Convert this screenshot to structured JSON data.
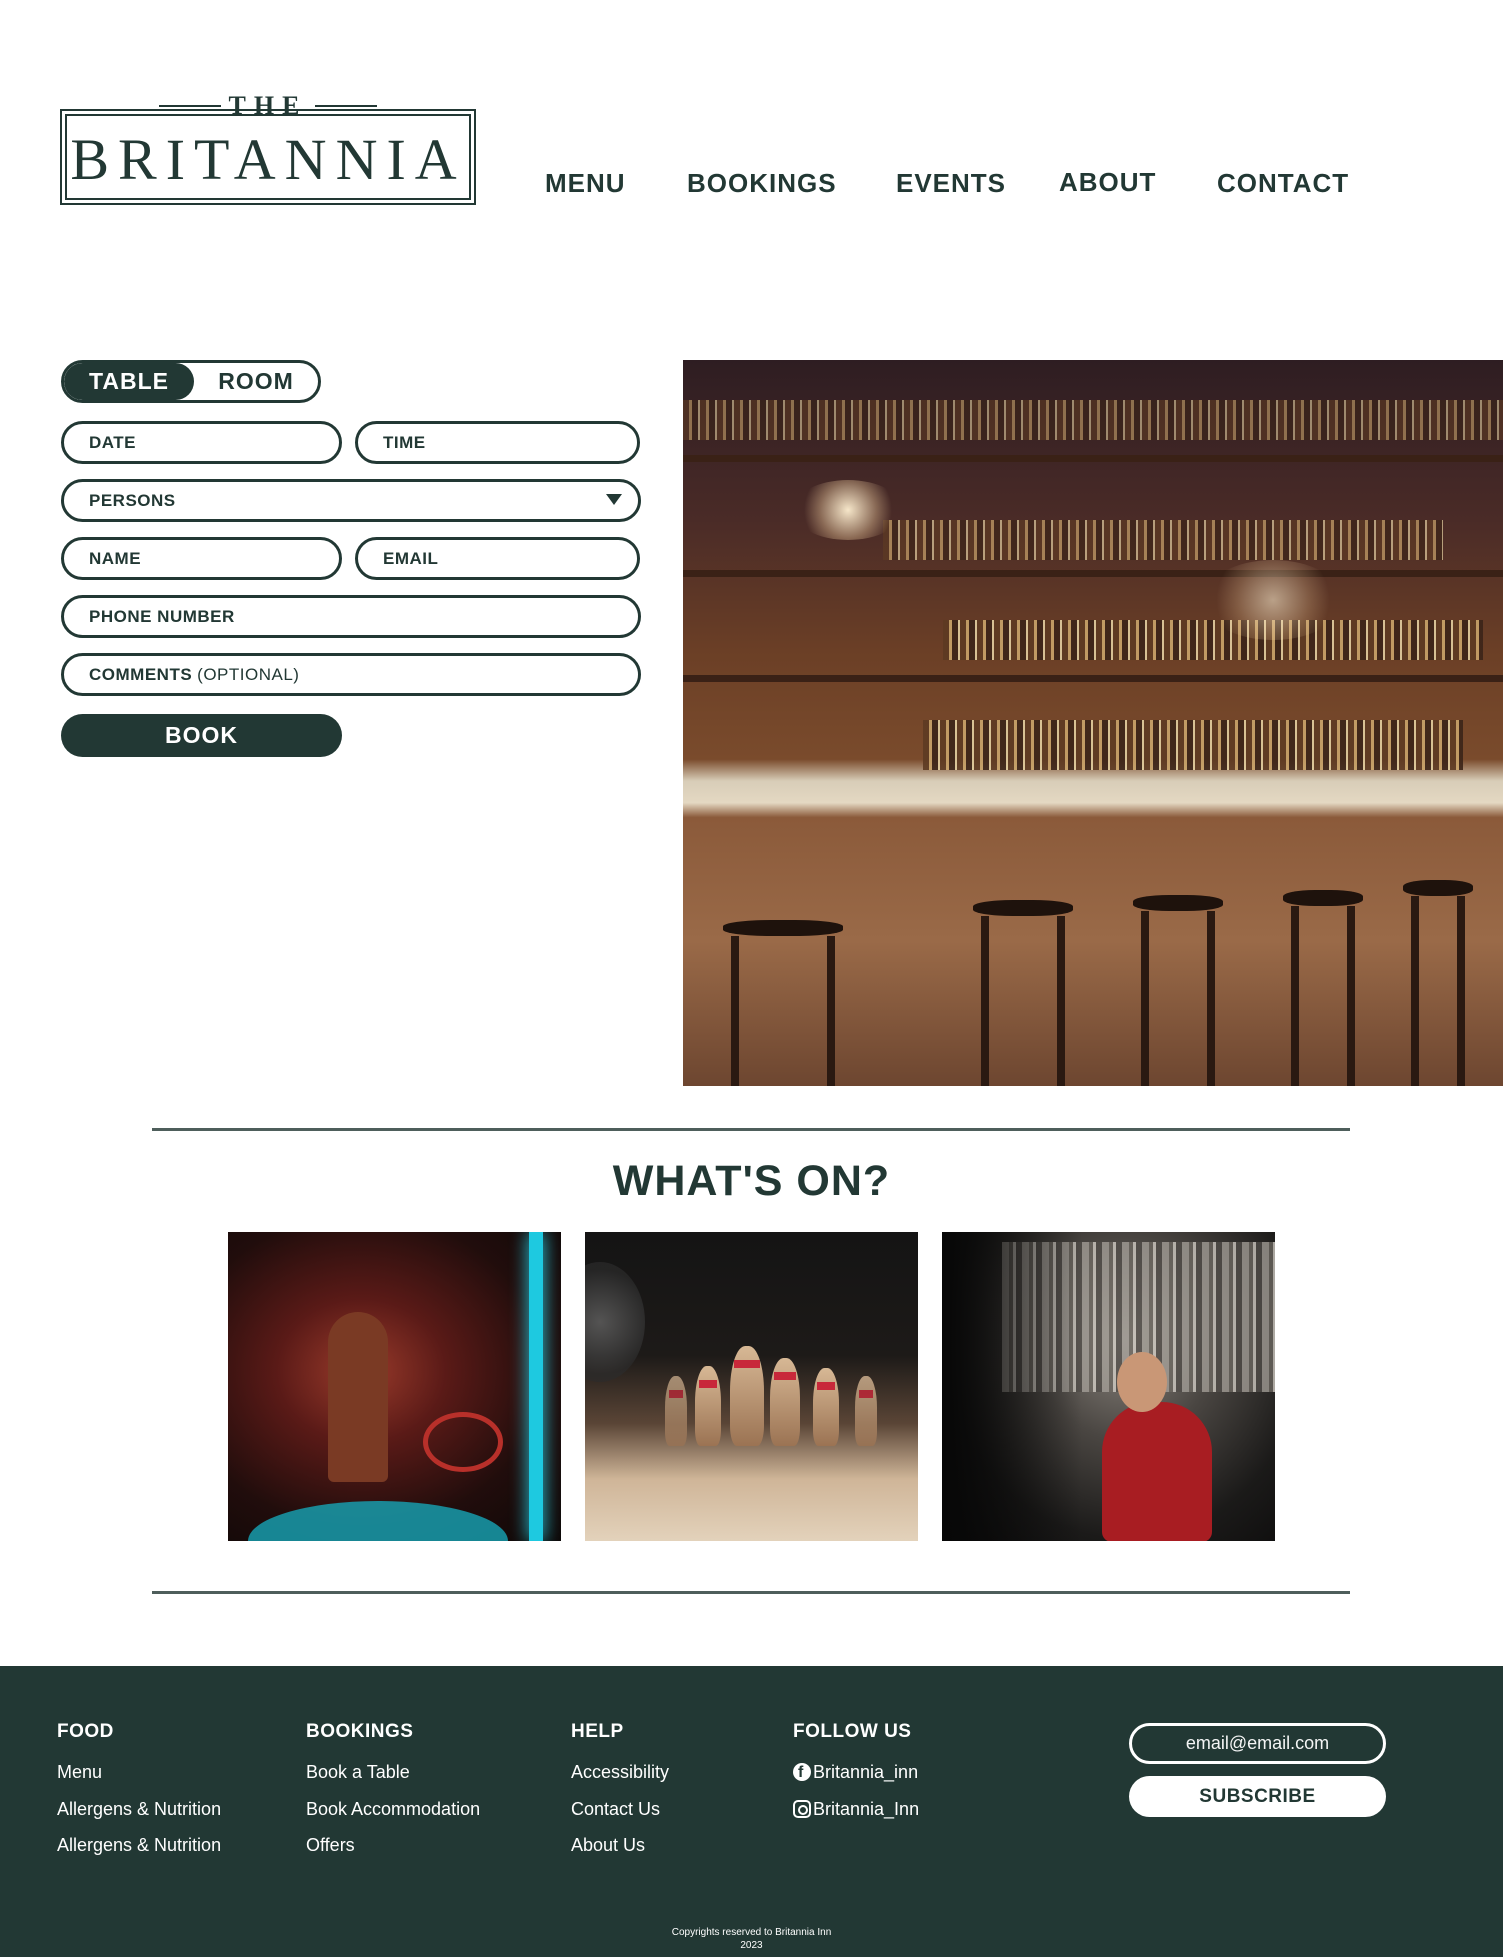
{
  "brand": {
    "logo_top": "THE",
    "logo_name": "BRITANNIA",
    "color_primary": "#223834",
    "color_background": "#ffffff"
  },
  "nav": {
    "menu": "MENU",
    "bookings": "BOOKINGS",
    "events": "EVENTS",
    "about": "ABOUT",
    "contact": "CONTACT"
  },
  "booking": {
    "toggle": {
      "table": "TABLE",
      "room": "ROOM",
      "selected": "TABLE"
    },
    "fields": {
      "date": "DATE",
      "time": "TIME",
      "persons": "PERSONS",
      "name": "NAME",
      "email": "EMAIL",
      "phone": "PHONE NUMBER",
      "comments": "COMMENTS",
      "comments_note": "(OPTIONAL)"
    },
    "book_label": "BOOK"
  },
  "whats_on": {
    "title": "WHAT'S ON?"
  },
  "footer": {
    "food": {
      "heading": "FOOD",
      "links": [
        "Menu",
        "Allergens & Nutrition",
        "Allergens & Nutrition"
      ]
    },
    "bookings": {
      "heading": "BOOKINGS",
      "links": [
        "Book a Table",
        "Book Accommodation",
        "Offers"
      ]
    },
    "help": {
      "heading": "HELP",
      "links": [
        "Accessibility",
        "Contact Us",
        "About Us"
      ]
    },
    "follow": {
      "heading": "FOLLOW US",
      "facebook": {
        "icon": "facebook-icon",
        "handle": "Britannia_inn"
      },
      "instagram": {
        "icon": "instagram-icon",
        "handle": "Britannia_Inn"
      }
    },
    "newsletter": {
      "email_placeholder": "email@email.com",
      "subscribe_label": "SUBSCRIBE"
    },
    "copyright_line1": "Copyrights reserved to Britannia Inn",
    "copyright_line2": "2023"
  }
}
